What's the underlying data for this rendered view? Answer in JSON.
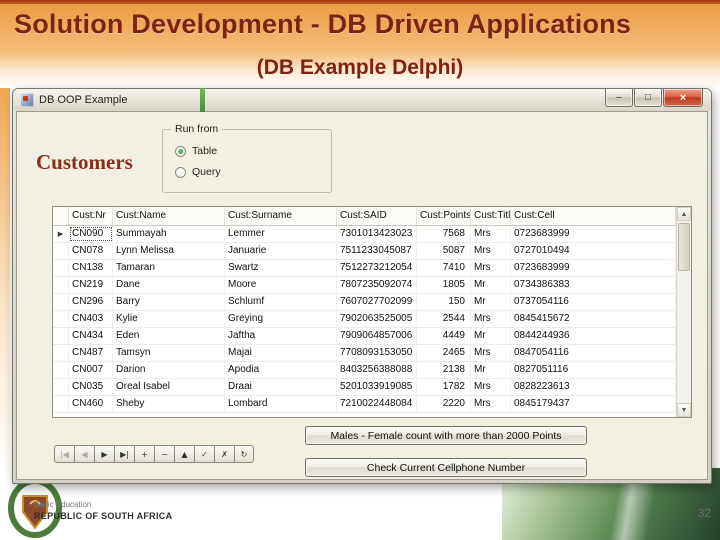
{
  "slide": {
    "title": "Solution Development - DB Driven Applications",
    "subtitle": "(DB Example Delphi)",
    "page_number": "32",
    "footer": {
      "department": "Basic Education",
      "country": "REPUBLIC OF SOUTH AFRICA"
    }
  },
  "window": {
    "title": "DB OOP Example",
    "controls": {
      "minimize": "–",
      "maximize": "□",
      "close": "×"
    },
    "customers_label": "Customers",
    "run_from": {
      "label": "Run from",
      "options": [
        {
          "label": "Table",
          "selected": true
        },
        {
          "label": "Query",
          "selected": false
        }
      ]
    },
    "grid": {
      "columns": [
        "Cust:Nr",
        "Cust:Name",
        "Cust:Surname",
        "Cust:SAID",
        "Cust:Points",
        "Cust:Title",
        "Cust:Cell"
      ],
      "selected_row": 0,
      "rows": [
        [
          "CN090",
          "Summayah",
          "Lemmer",
          "7301013423023",
          "7568",
          "Mrs",
          "0723683999"
        ],
        [
          "CN078",
          "Lynn Melissa",
          "Januarie",
          "7511233045087",
          "5087",
          "Mrs",
          "0727010494"
        ],
        [
          "CN138",
          "Tamaran",
          "Swartz",
          "7512273212054",
          "7410",
          "Mrs",
          "0723683999"
        ],
        [
          "CN219",
          "Dane",
          "Moore",
          "7807235092074",
          "1805",
          "Mr",
          "0734386383"
        ],
        [
          "CN296",
          "Barry",
          "Schlumf",
          "7607027702099",
          "150",
          "Mr",
          "0737054116"
        ],
        [
          "CN403",
          "Kylie",
          "Greying",
          "7902063525005",
          "2544",
          "Mrs",
          "0845415672"
        ],
        [
          "CN434",
          "Eden",
          "Jaftha",
          "7909064857006",
          "4449",
          "Mr",
          "0844244936"
        ],
        [
          "CN487",
          "Tamsyn",
          "Majai",
          "7708093153050",
          "2465",
          "Mrs",
          "0847054116"
        ],
        [
          "CN007",
          "Darion",
          "Apodia",
          "8403256388088",
          "2138",
          "Mr",
          "0827051116"
        ],
        [
          "CN035",
          "Oreal Isabel",
          "Draai",
          "5201033919085",
          "1782",
          "Mrs",
          "0828223613"
        ],
        [
          "CN460",
          "Sheby",
          "Lombard",
          "7210022448084",
          "2220",
          "Mrs",
          "0845179437"
        ]
      ]
    },
    "navigator": [
      {
        "name": "first",
        "glyph": "|◀",
        "enabled": false
      },
      {
        "name": "prior",
        "glyph": "◀",
        "enabled": false
      },
      {
        "name": "next",
        "glyph": "▶",
        "enabled": true
      },
      {
        "name": "last",
        "glyph": "▶|",
        "enabled": true
      },
      {
        "name": "insert",
        "glyph": "+",
        "enabled": true
      },
      {
        "name": "delete",
        "glyph": "−",
        "enabled": true
      },
      {
        "name": "edit",
        "glyph": "▲",
        "enabled": true
      },
      {
        "name": "post",
        "glyph": "✓",
        "enabled": true
      },
      {
        "name": "cancel",
        "glyph": "✗",
        "enabled": true
      },
      {
        "name": "refresh",
        "glyph": "↻",
        "enabled": true
      }
    ],
    "buttons": [
      "Males - Female count with more than 2000 Points",
      "Check Current Cellphone Number"
    ]
  },
  "icons": {
    "scroll_up": "▲",
    "scroll_down": "▼",
    "current_record": "▶"
  },
  "colors": {
    "header_orange": "#EC9C45",
    "title_maroon": "#7E2312",
    "customers_maroon": "#8C2E1B",
    "close_button_red": "#C03A1E",
    "photo_green": "#2F5B33"
  }
}
